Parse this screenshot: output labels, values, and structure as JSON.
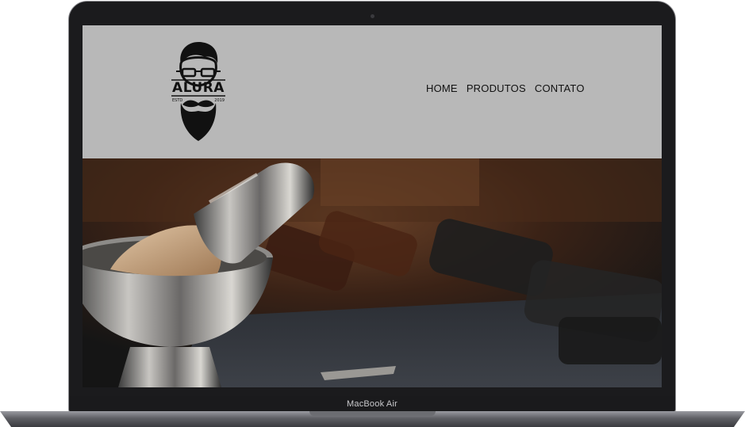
{
  "device": {
    "label": "MacBook Air"
  },
  "site": {
    "logo": {
      "name": "ALURA",
      "est": "ESTD",
      "year": "2019"
    },
    "nav": {
      "items": [
        {
          "label": "HOME"
        },
        {
          "label": "PRODUTOS"
        },
        {
          "label": "CONTATO"
        }
      ]
    },
    "hero": {
      "image": "barber-tools-photo"
    }
  },
  "colors": {
    "header_bg": "#b8b8b8",
    "nav_text": "#111111",
    "bezel": "#1b1b1d"
  }
}
